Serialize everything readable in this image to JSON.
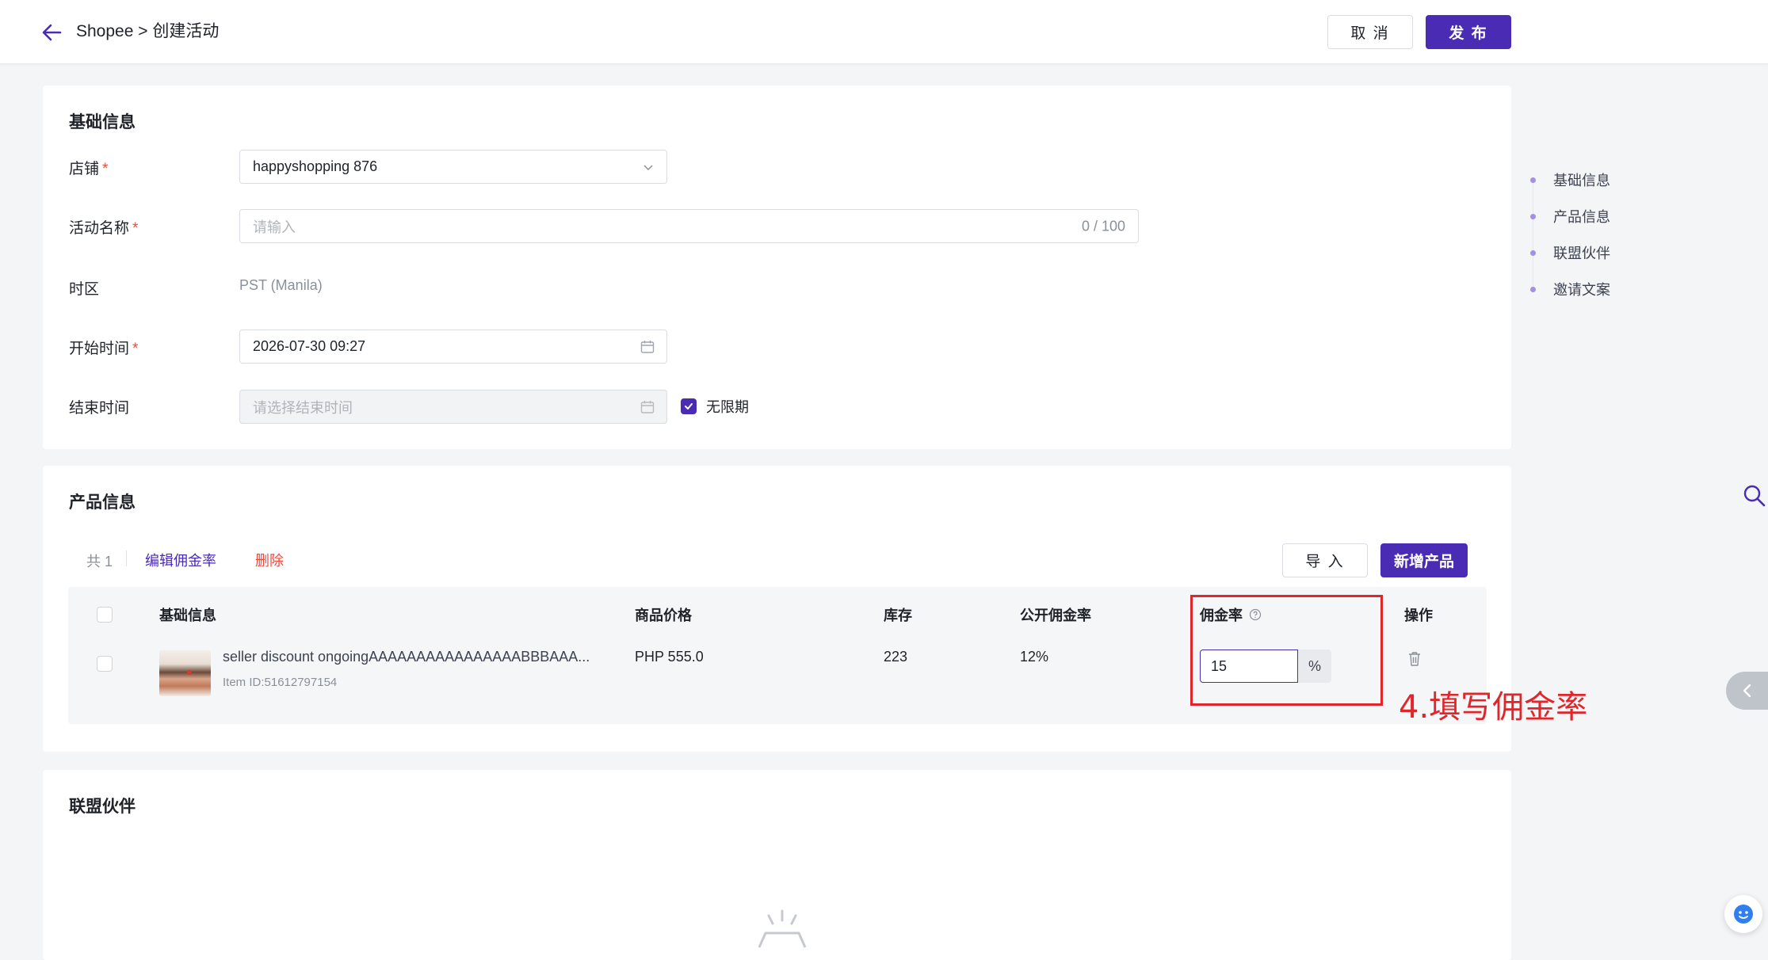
{
  "header": {
    "breadcrumb": "Shopee > 创建活动",
    "cancel_label": "取 消",
    "publish_label": "发 布"
  },
  "basic": {
    "title": "基础信息",
    "store_label": "店铺",
    "store_value": "happyshopping 876",
    "name_label": "活动名称",
    "name_placeholder": "请输入",
    "name_counter": "0 / 100",
    "timezone_label": "时区",
    "timezone_value": "PST (Manila)",
    "start_label": "开始时间",
    "start_value": "2026-07-30 09:27",
    "end_label": "结束时间",
    "end_placeholder": "请选择结束时间",
    "unlimited_label": "无限期",
    "required_mark": "*"
  },
  "products": {
    "title": "产品信息",
    "total_label": "共 1",
    "edit_rate_label": "编辑佣金率",
    "delete_label": "删除",
    "import_label": "导 入",
    "add_label": "新增产品",
    "columns": [
      "基础信息",
      "商品价格",
      "库存",
      "公开佣金率",
      "佣金率",
      "操作"
    ],
    "rows": [
      {
        "name": "seller discount ongoingAAAAAAAAAAAAAAAABBBAAA...",
        "item_id": "Item ID:51612797154",
        "price": "PHP 555.0",
        "stock": "223",
        "public_rate": "12%",
        "rate": "15",
        "rate_unit": "%"
      }
    ]
  },
  "partners": {
    "title": "联盟伙伴"
  },
  "anchor_nav": [
    "基础信息",
    "产品信息",
    "联盟伙伴",
    "邀请文案"
  ],
  "annotation": {
    "text": "4.填写佣金率"
  },
  "colors": {
    "primary": "#4a2bb3",
    "danger": "#f5483b",
    "annotation": "#e0262b"
  }
}
